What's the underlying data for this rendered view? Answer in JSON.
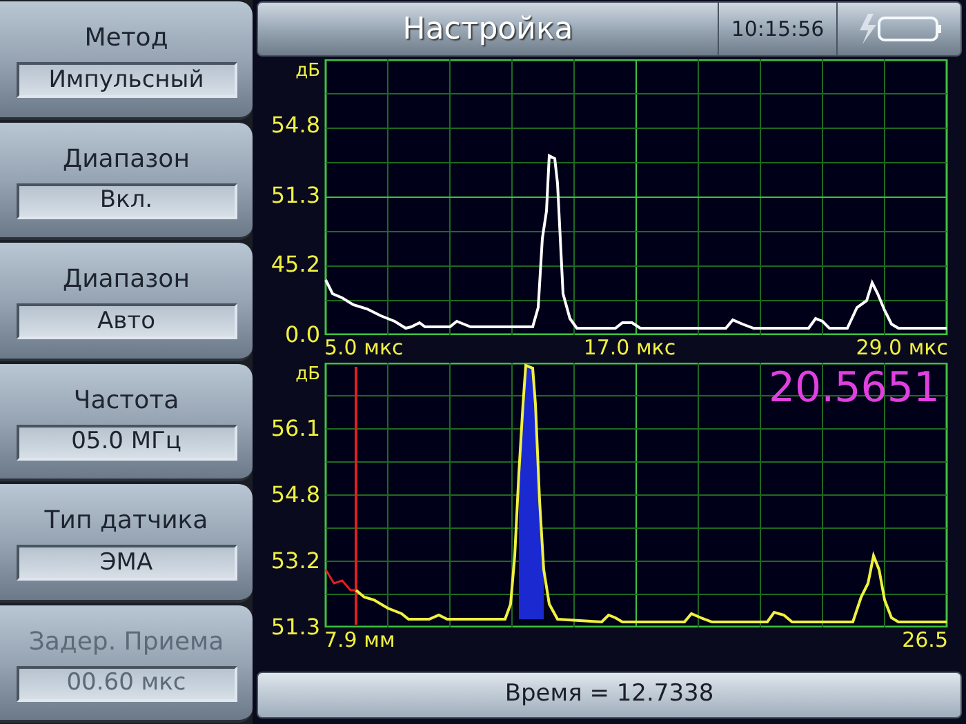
{
  "header": {
    "title": "Настройка",
    "time": "10:15:56"
  },
  "menu": [
    {
      "label": "Метод",
      "value": "Импульсный",
      "disabled": false
    },
    {
      "label": "Диапазон",
      "value": "Вкл.",
      "disabled": false
    },
    {
      "label": "Диапазон",
      "value": "Авто",
      "disabled": false
    },
    {
      "label": "Частота",
      "value": "05.0 МГц",
      "disabled": false
    },
    {
      "label": "Тип датчика",
      "value": "ЭМА",
      "disabled": false
    },
    {
      "label": "Задер. Приема",
      "value": "00.60 мкс",
      "disabled": true
    }
  ],
  "charts": [
    {
      "kind": "ascan",
      "y_unit": "дБ",
      "y_labels": [
        "54.8",
        "51.3",
        "45.2",
        "0.0"
      ],
      "x_labels": [
        "5.0 мкс",
        "17.0 мкс",
        "29.0 мкс"
      ]
    },
    {
      "kind": "ascan_gated",
      "y_unit": "дБ",
      "y_labels": [
        "56.1",
        "54.8",
        "53.2",
        "51.3"
      ],
      "x_labels": [
        "7.9 мм",
        "26.5"
      ],
      "reading": "20.5651"
    }
  ],
  "status_bar": {
    "text": "Время = 12.7338"
  }
}
